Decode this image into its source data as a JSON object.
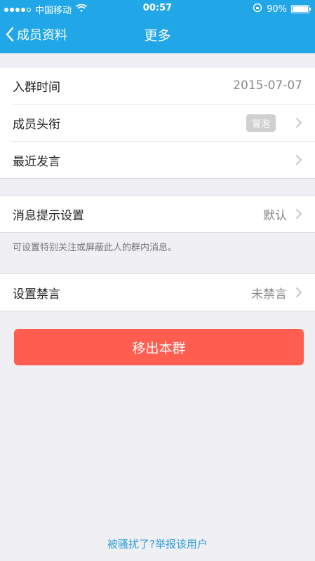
{
  "status": {
    "carrier": "中国移动",
    "time": "00:57",
    "battery": "90%"
  },
  "nav": {
    "back_label": "成员资料",
    "title": "更多"
  },
  "group1": {
    "join_label": "入群时间",
    "join_value": "2015-07-07",
    "title_label": "成员头衔",
    "title_badge": "冒泡",
    "recent_label": "最近发言"
  },
  "group2": {
    "notify_label": "消息提示设置",
    "notify_value": "默认",
    "hint": "可设置特别关注或屏蔽此人的群内消息。"
  },
  "group3": {
    "mute_label": "设置禁言",
    "mute_value": "未禁言"
  },
  "actions": {
    "remove_label": "移出本群",
    "report_link": "被骚扰了?举报该用户"
  },
  "colors": {
    "accent": "#21a7e8",
    "danger": "#ff5e51",
    "link": "#2e9ed6"
  }
}
